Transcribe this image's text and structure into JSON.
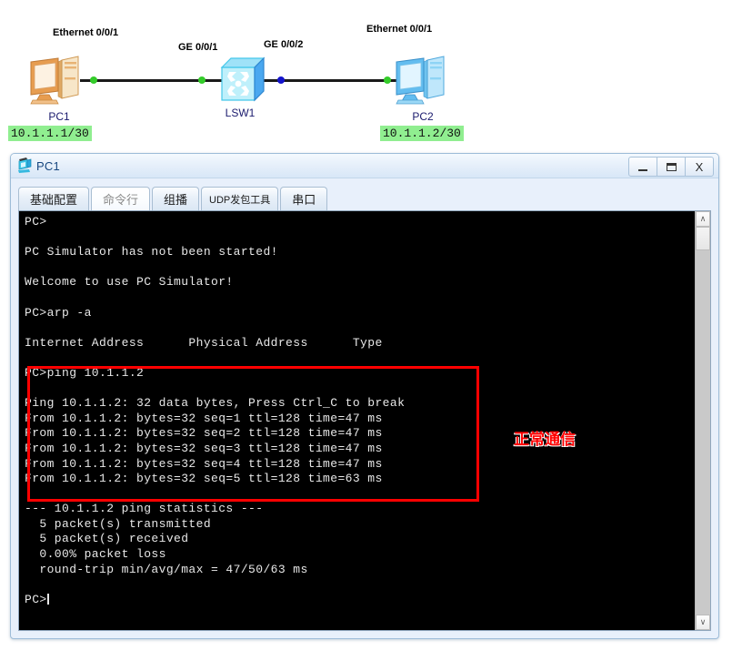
{
  "topology": {
    "devices": [
      {
        "id": "pc1",
        "name": "PC1",
        "ip": "10.1.1.1/30",
        "interface": "Ethernet 0/0/1"
      },
      {
        "id": "lsw1",
        "name": "LSW1",
        "interface_left": "GE 0/0/1",
        "interface_right": "GE 0/0/2"
      },
      {
        "id": "pc2",
        "name": "PC2",
        "ip": "10.1.1.2/30",
        "interface": "Ethernet 0/0/1"
      }
    ],
    "link_status_colors": {
      "up": "#34cc2a",
      "blocked": "#1414cc"
    }
  },
  "window": {
    "title": "PC1",
    "icon": "pc-device-icon",
    "buttons": {
      "minimize": "_",
      "maximize": "□",
      "close": "X"
    }
  },
  "tabs": [
    {
      "label": "基础配置",
      "selected": false
    },
    {
      "label": "命令行",
      "selected": true
    },
    {
      "label": "组播",
      "selected": false
    },
    {
      "label": "UDP发包工具",
      "selected": false
    },
    {
      "label": "串口",
      "selected": false
    }
  ],
  "terminal": {
    "lines": [
      "PC>",
      "",
      "PC Simulator has not been started!",
      "",
      "Welcome to use PC Simulator!",
      "",
      "PC>arp -a",
      "",
      "Internet Address      Physical Address      Type",
      "",
      "PC>ping 10.1.1.2",
      "",
      "Ping 10.1.1.2: 32 data bytes, Press Ctrl_C to break",
      "From 10.1.1.2: bytes=32 seq=1 ttl=128 time=47 ms",
      "From 10.1.1.2: bytes=32 seq=2 ttl=128 time=47 ms",
      "From 10.1.1.2: bytes=32 seq=3 ttl=128 time=47 ms",
      "From 10.1.1.2: bytes=32 seq=4 ttl=128 time=47 ms",
      "From 10.1.1.2: bytes=32 seq=5 ttl=128 time=63 ms",
      "",
      "--- 10.1.1.2 ping statistics ---",
      "  5 packet(s) transmitted",
      "  5 packet(s) received",
      "  0.00% packet loss",
      "  round-trip min/avg/max = 47/50/63 ms",
      "",
      "PC>"
    ]
  },
  "annotation": {
    "text": "正常通信",
    "color": "#ff0000"
  },
  "scrollbar": {
    "up_arrow": "∧",
    "down_arrow": "∨"
  }
}
